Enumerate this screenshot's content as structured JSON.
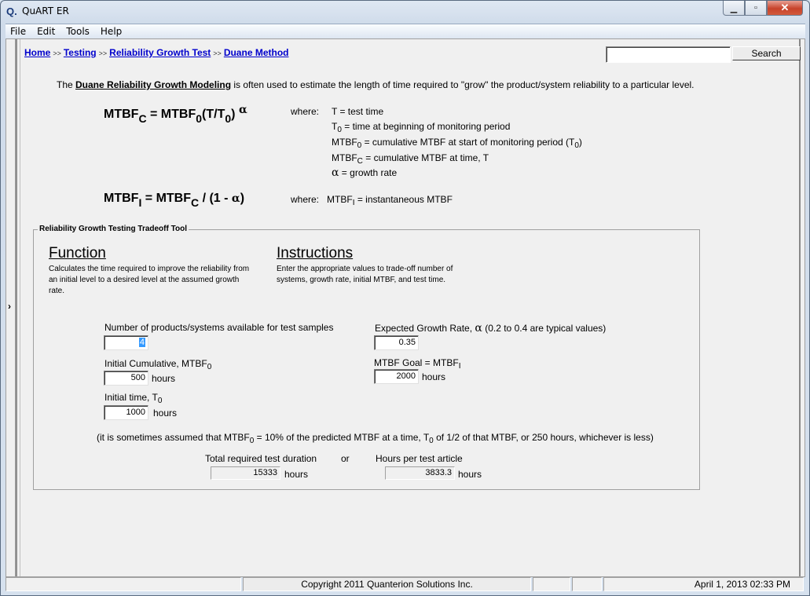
{
  "window": {
    "title": "QuART ER",
    "app_icon": "Q.",
    "controls": {
      "minimize": "minimize",
      "maximize": "maximize",
      "close": "close"
    }
  },
  "menu": [
    "File",
    "Edit",
    "Tools",
    "Help"
  ],
  "breadcrumb": {
    "items": [
      "Home",
      "Testing",
      "Reliability Growth Test",
      "Duane Method"
    ],
    "separator": ">>"
  },
  "search": {
    "value": "",
    "placeholder": "",
    "button_label": "Search"
  },
  "intro": {
    "prefix": "The ",
    "link": "Duane Reliability Growth Modeling",
    "suffix": " is often used to estimate the length of time required to \"grow\" the product/system reliability to a particular level."
  },
  "formula1": {
    "lhs_main": "MTBF",
    "lhs_sub": "C",
    "eq": " = MTBF",
    "sub0": "0",
    "paren": "(T/T",
    "sub1": "0",
    "close": ")",
    "exp": "α"
  },
  "where1": {
    "label": "where:",
    "lines": [
      {
        "pre": "T = test time",
        "sub": "",
        "post": ""
      },
      {
        "pre": "T",
        "sub": "0",
        "post": " = time at beginning of monitoring period"
      },
      {
        "pre": "MTBF",
        "sub": "0",
        "post": " = cumulative MTBF at start of monitoring period (T"
      },
      {
        "pre": "MTBF",
        "sub": "C",
        "post": " = cumulative MTBF at time, T"
      },
      {
        "pre": "α",
        "sub": "",
        "post": " = growth rate"
      }
    ],
    "line3_tail_sub": "0",
    "line3_tail": ")"
  },
  "formula2": {
    "lhs_main": "MTBF",
    "lhs_sub": "I",
    "eq": " = MTBF",
    "sub": "C",
    "rest": " / (1 - ",
    "alpha": "α",
    "close": ")"
  },
  "where2": {
    "label": "where:",
    "pre": "MTBF",
    "sub": "I",
    "post": " = instantaneous MTBF"
  },
  "tool": {
    "title": "Reliability Growth Testing Tradeoff Tool",
    "function": {
      "heading": "Function",
      "text": "Calculates the time required to improve the reliability from an initial level to a desired level at the assumed growth rate."
    },
    "instructions": {
      "heading": "Instructions",
      "text": "Enter the appropriate values to trade-off number of systems, growth rate, initial MTBF, and test time."
    },
    "fields": {
      "num_products": {
        "label": "Number of products/systems available for test samples",
        "value": "4"
      },
      "initial_mtbf": {
        "label": "Initial Cumulative, MTBF",
        "label_sub": "0",
        "value": "500",
        "unit": "hours"
      },
      "initial_time": {
        "label": "Initial time, T",
        "label_sub": "0",
        "value": "1000",
        "unit": "hours"
      },
      "growth_rate": {
        "label": "Expected Growth Rate, ",
        "alpha": "α",
        "hint": "  (0.2 to 0.4 are typical values)",
        "value": "0.35"
      },
      "mtbf_goal": {
        "label": "MTBF Goal = MTBF",
        "label_sub": "I",
        "value": "2000",
        "unit": "hours"
      }
    },
    "note": {
      "a": "(it is sometimes assumed that MTBF",
      "a_sub": "0",
      "b": " = 10% of the predicted MTBF at a time, T",
      "b_sub": "0",
      "c": " of 1/2 of that MTBF, or 250 hours, whichever is less)"
    },
    "results": {
      "total_label": "Total required test duration",
      "or": "or",
      "per_article_label": "Hours per test article",
      "total_value": "15333",
      "per_article_value": "3833.3",
      "unit": "hours"
    }
  },
  "statusbar": {
    "copyright": "Copyright 2011 Quanterion Solutions Inc.",
    "datetime": "April 1, 2013  02:33 PM"
  }
}
